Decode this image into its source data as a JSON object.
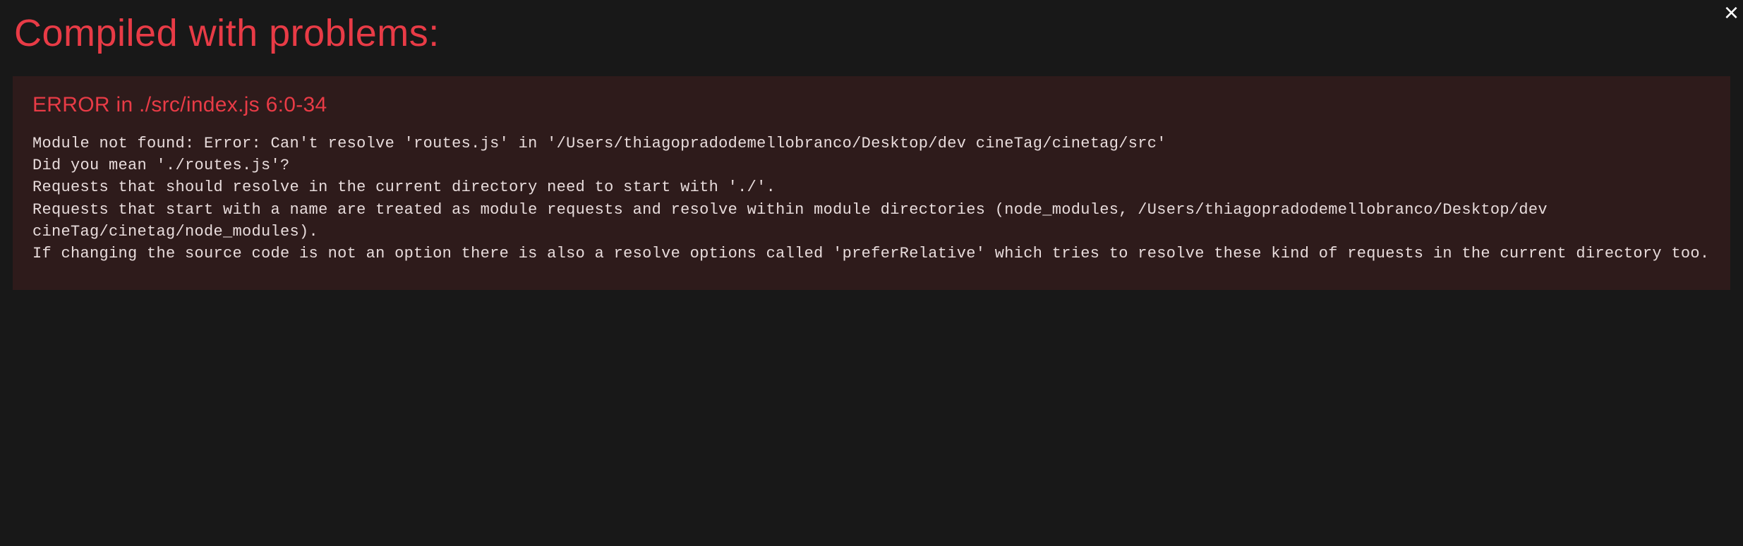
{
  "header": {
    "title": "Compiled with problems:"
  },
  "closeLabel": "×",
  "error": {
    "title": "ERROR in ./src/index.js 6:0-34",
    "message": "Module not found: Error: Can't resolve 'routes.js' in '/Users/thiagopradodemellobranco/Desktop/dev cineTag/cinetag/src'\nDid you mean './routes.js'?\nRequests that should resolve in the current directory need to start with './'.\nRequests that start with a name are treated as module requests and resolve within module directories (node_modules, /Users/thiagopradodemellobranco/Desktop/dev cineTag/cinetag/node_modules).\nIf changing the source code is not an option there is also a resolve options called 'preferRelative' which tries to resolve these kind of requests in the current directory too."
  }
}
